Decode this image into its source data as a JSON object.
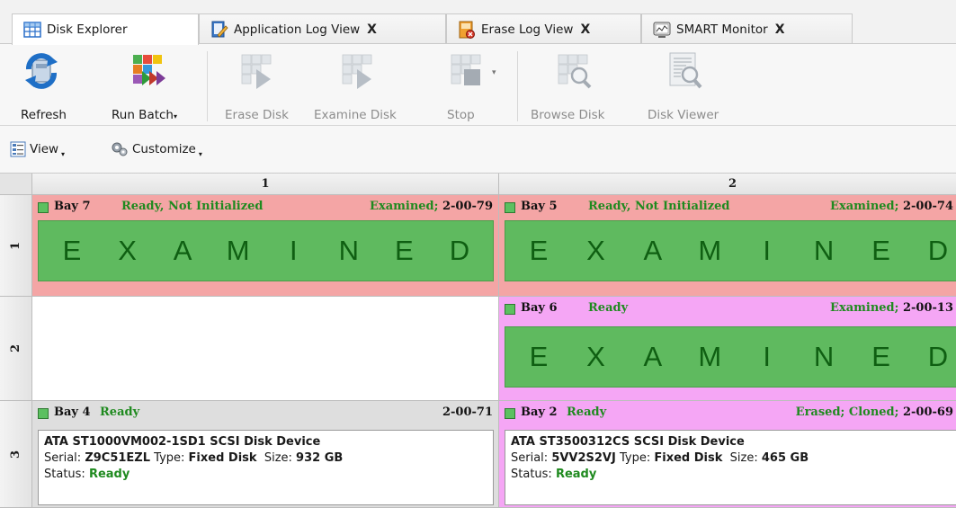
{
  "tabs": [
    {
      "label": "Disk Explorer",
      "icon": "grid-icon",
      "active": true,
      "closable": false
    },
    {
      "label": "Application Log View",
      "icon": "log-edit-icon",
      "active": false,
      "closable": true
    },
    {
      "label": "Erase Log View",
      "icon": "erase-log-icon",
      "active": false,
      "closable": true
    },
    {
      "label": "SMART Monitor",
      "icon": "monitor-icon",
      "active": false,
      "closable": true
    }
  ],
  "close_glyph": "X",
  "ribbon": {
    "refresh": "Refresh",
    "run_batch": "Run Batch",
    "erase_disk": "Erase Disk",
    "examine_disk": "Examine Disk",
    "stop": "Stop",
    "browse_disk": "Browse Disk",
    "disk_viewer": "Disk Viewer"
  },
  "toolbar": {
    "view": "View",
    "customize": "Customize"
  },
  "grid": {
    "columns": [
      "1",
      "2"
    ],
    "rows": [
      "1",
      "2",
      "3"
    ],
    "stamp_letters": [
      "E",
      "X",
      "A",
      "M",
      "I",
      "N",
      "E",
      "D"
    ],
    "cells": {
      "r1c1": {
        "bay": "Bay 7",
        "status": "Ready, Not Initialized",
        "tags": "Examined;",
        "id": "2-00-79"
      },
      "r1c2": {
        "bay": "Bay 5",
        "status": "Ready, Not Initialized",
        "tags": "Examined;",
        "id": "2-00-74"
      },
      "r2c2": {
        "bay": "Bay 6",
        "status": "Ready",
        "tags": "Examined;",
        "id": "2-00-13"
      },
      "r3c1": {
        "bay": "Bay 4",
        "status": "Ready",
        "tags": "",
        "id": "2-00-71",
        "device": "ATA ST1000VM002-1SD1 SCSI Disk Device",
        "serial": "Z9C51EZL",
        "type": "Fixed Disk",
        "size": "932 GB",
        "disk_status": "Ready"
      },
      "r3c2": {
        "bay": "Bay 2",
        "status": "Ready",
        "tags": "Erased; Cloned;",
        "id": "2-00-69",
        "device": "ATA ST3500312CS SCSI Disk Device",
        "serial": "5VV2S2VJ",
        "type": "Fixed Disk",
        "size": "465 GB",
        "disk_status": "Ready"
      }
    },
    "info_labels": {
      "serial": "Serial:",
      "type": "Type:",
      "size": "Size:",
      "status": "Status:"
    }
  },
  "colors": {
    "examined_green": "#5fba5f",
    "bay_pink": "#f4a5a5",
    "bay_magenta": "#f5a6f5",
    "status_green": "#1f8a1f"
  }
}
